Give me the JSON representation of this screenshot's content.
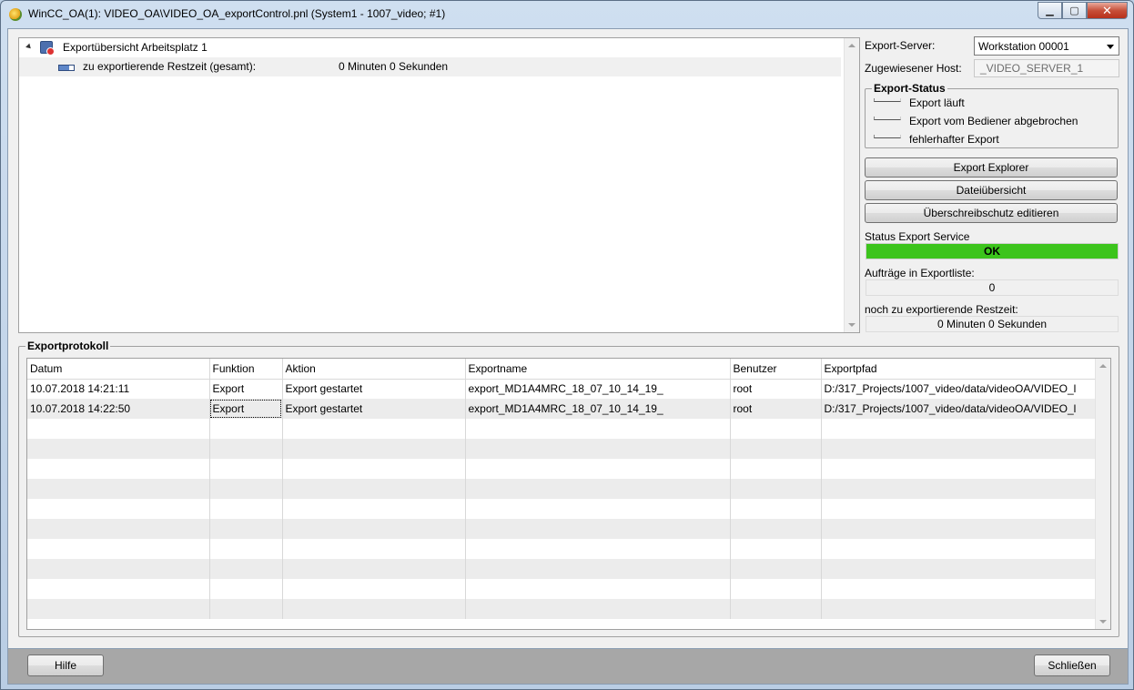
{
  "window": {
    "title": "WinCC_OA(1): VIDEO_OA\\VIDEO_OA_exportControl.pnl (System1 - 1007_video; #1)",
    "min_glyph": "▁",
    "max_glyph": "▢",
    "close_glyph": "✕"
  },
  "tree": {
    "root_label": "Exportübersicht Arbeitsplatz 1",
    "child_label": "zu exportierende Restzeit (gesamt):",
    "child_value": "0 Minuten  0 Sekunden"
  },
  "right_panel": {
    "export_server_label": "Export-Server:",
    "export_server_value": "Workstation  00001",
    "host_label": "Zugewiesener Host:",
    "host_value": "_VIDEO_SERVER_1",
    "status_group_title": "Export-Status",
    "status_items": [
      "Export läuft",
      "Export vom Bediener abgebrochen",
      "fehlerhafter Export"
    ],
    "btn_explorer": "Export Explorer",
    "btn_files": "Dateiübersicht",
    "btn_protect": "Überschreibschutz editieren",
    "service_label": "Status Export Service",
    "service_value": "OK",
    "service_color": "#3cc41c",
    "jobs_label": "Aufträge in Exportliste:",
    "jobs_value": "0",
    "remaining_label": "noch zu exportierende Restzeit:",
    "remaining_value": "0 Minuten  0 Sekunden"
  },
  "protocol": {
    "group_title": "Exportprotokoll",
    "columns": [
      "Datum",
      "Funktion",
      "Aktion",
      "Exportname",
      "Benutzer",
      "Exportpfad"
    ],
    "rows": [
      [
        "10.07.2018 14:21:11",
        "Export",
        "Export gestartet",
        "export_MD1A4MRC_18_07_10_14_19_",
        "root",
        "D:/317_Projects/1007_video/data/videoOA/VIDEO_l"
      ],
      [
        "10.07.2018 14:22:50",
        "Export",
        "Export gestartet",
        "export_MD1A4MRC_18_07_10_14_19_",
        "root",
        "D:/317_Projects/1007_video/data/videoOA/VIDEO_l"
      ]
    ],
    "empty_rows": 10
  },
  "footer": {
    "help_label": "Hilfe",
    "close_label": "Schließen"
  }
}
